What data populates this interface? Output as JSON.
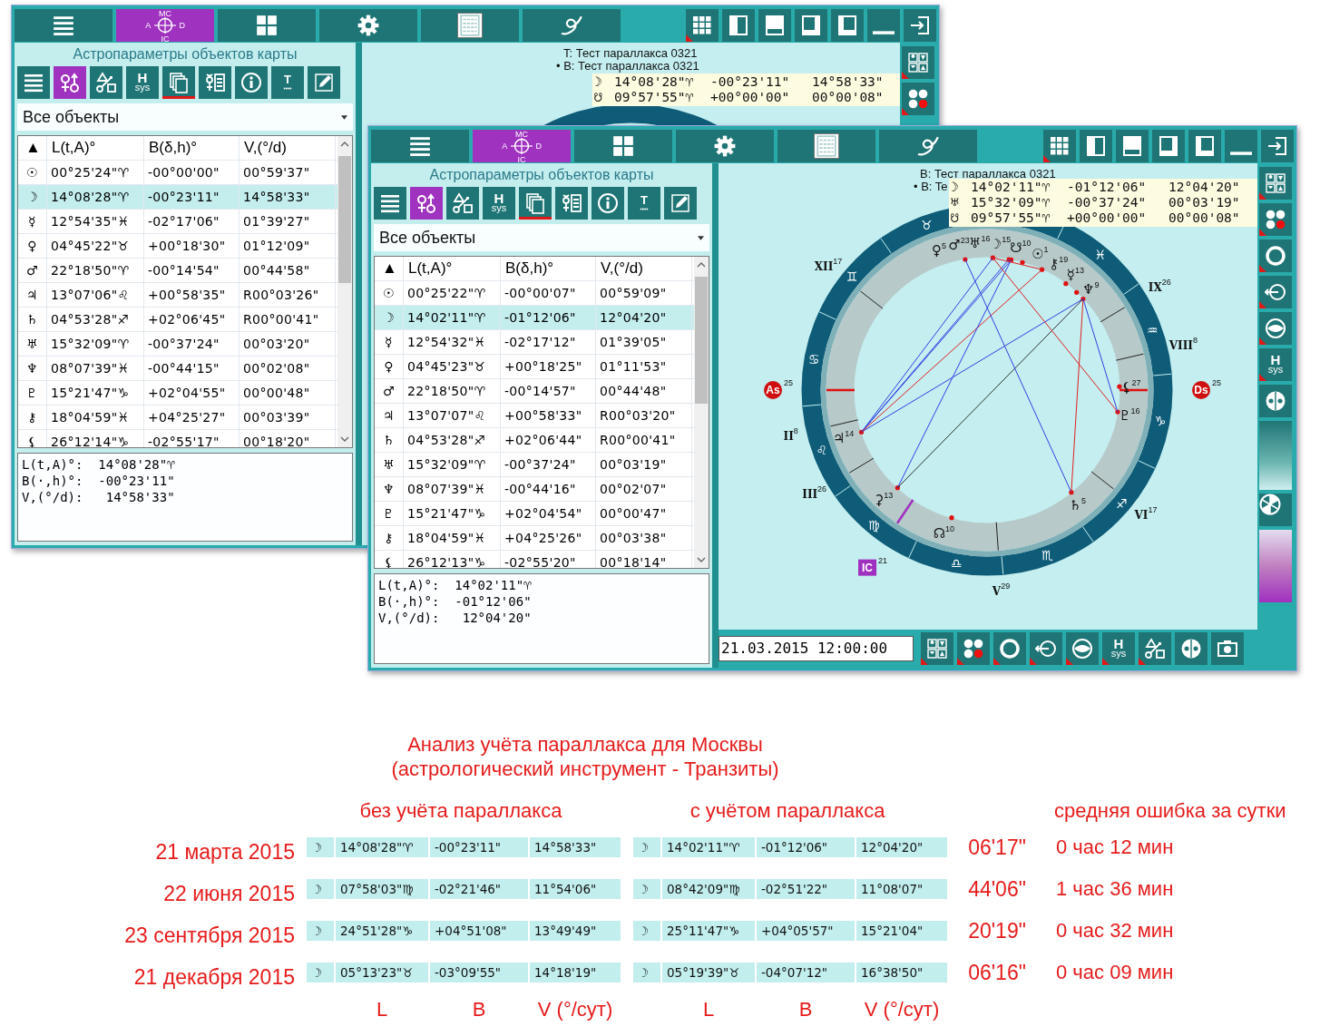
{
  "back_window": {
    "main_tabs": [
      {
        "kind": "list",
        "selected": false
      },
      {
        "kind": "cross",
        "labels": [
          "MC",
          "A",
          "D",
          "IC"
        ],
        "selected": true
      },
      {
        "kind": "grid4",
        "selected": false
      },
      {
        "kind": "gear",
        "selected": false
      },
      {
        "kind": "table",
        "selected": false
      },
      {
        "kind": "swirl",
        "selected": false
      }
    ],
    "layout_buttons": [
      {
        "kind": "grid9",
        "marked": true
      },
      {
        "kind": "split-left",
        "marked": false
      },
      {
        "kind": "pane-top",
        "marked": false
      },
      {
        "kind": "pane-bottom-left",
        "marked": false
      },
      {
        "kind": "pane-top-right",
        "marked": false
      },
      {
        "kind": "minimize",
        "marked": false
      },
      {
        "kind": "exit",
        "marked": false
      }
    ],
    "panel": {
      "title": "Астропараметры объектов карты",
      "tools": [
        {
          "kind": "list",
          "selected": false,
          "active": false
        },
        {
          "kind": "planets",
          "selected": true,
          "active": false
        },
        {
          "kind": "aspects",
          "selected": false,
          "active": false
        },
        {
          "kind": "house-system",
          "label_lines": [
            "H",
            "sys"
          ],
          "selected": false,
          "active": false
        },
        {
          "kind": "copy",
          "selected": false,
          "active": true
        },
        {
          "kind": "glyph-list",
          "selected": false,
          "active": false
        },
        {
          "kind": "info",
          "selected": false,
          "active": false
        },
        {
          "kind": "dots-line",
          "label": "T",
          "selected": false,
          "active": false
        },
        {
          "kind": "edit",
          "selected": false,
          "active": false
        }
      ],
      "filter": "Все объекты",
      "columns": [
        "▲",
        "L(t,A)°",
        "B(δ,h)°",
        "V,(°/d)"
      ],
      "rows": [
        {
          "symbol": "☉",
          "longitude": "00°25'24\"♈",
          "latitude": "-00°00'00\"",
          "speed": "00°59'37\"",
          "selected": false
        },
        {
          "symbol": "☽",
          "longitude": "14°08'28\"♈",
          "latitude": "-00°23'11\"",
          "speed": "14°58'33\"",
          "selected": true
        },
        {
          "symbol": "☿",
          "longitude": "12°54'35\"♓",
          "latitude": "-02°17'06\"",
          "speed": "01°39'27\"",
          "selected": false
        },
        {
          "symbol": "♀",
          "longitude": "04°45'22\"♉",
          "latitude": "+00°18'30\"",
          "speed": "01°12'09\"",
          "selected": false
        },
        {
          "symbol": "♂",
          "longitude": "22°18'50\"♈",
          "latitude": "-00°14'54\"",
          "speed": "00°44'58\"",
          "selected": false
        },
        {
          "symbol": "♃",
          "longitude": "13°07'06\"♌",
          "latitude": "+00°58'35\"",
          "speed": "R00°03'26\"",
          "selected": false
        },
        {
          "symbol": "♄",
          "longitude": "04°53'28\"♐",
          "latitude": "+02°06'45\"",
          "speed": "R00°00'41\"",
          "selected": false
        },
        {
          "symbol": "♅",
          "longitude": "15°32'09\"♈",
          "latitude": "-00°37'24\"",
          "speed": "00°03'20\"",
          "selected": false
        },
        {
          "symbol": "♆",
          "longitude": "08°07'39\"♓",
          "latitude": "-00°44'15\"",
          "speed": "00°02'08\"",
          "selected": false
        },
        {
          "symbol": "♇",
          "longitude": "15°21'47\"♑",
          "latitude": "+02°04'55\"",
          "speed": "00°00'48\"",
          "selected": false
        },
        {
          "symbol": "⚷",
          "longitude": "18°04'59\"♓",
          "latitude": "+04°25'27\"",
          "speed": "00°03'39\"",
          "selected": false
        },
        {
          "symbol": "⚸",
          "longitude": "26°12'14\"♑",
          "latitude": "-02°55'17\"",
          "speed": "00°18'20\"",
          "selected": false
        }
      ],
      "details": [
        "L(t,A)°:  14°08'28\"♈",
        "B(·,h)°:  -00°23'11\"",
        "V,(°/d):   14°58'33\""
      ]
    },
    "chart": {
      "header": [
        "T: Тест параллакса 0321",
        "• B: Тест параллакса 0321"
      ],
      "tooltip": [
        {
          "symbol": "☽",
          "longitude": "14°08'28\"♈",
          "latitude": "-00°23'11\"",
          "speed": "14°58'33\""
        },
        {
          "symbol": "☋",
          "longitude": "09°57'55\"♈",
          "latitude": "+00°00'00\"",
          "speed": "00°00'08\""
        }
      ],
      "side_tools": [
        {
          "kind": "figures",
          "marked": true
        },
        {
          "kind": "dots",
          "marked": true
        }
      ]
    }
  },
  "front_window": {
    "main_tabs": [
      {
        "kind": "list",
        "selected": false
      },
      {
        "kind": "cross",
        "labels": [
          "MC",
          "A",
          "D",
          "IC"
        ],
        "selected": true
      },
      {
        "kind": "grid4",
        "selected": false
      },
      {
        "kind": "gear",
        "selected": false
      },
      {
        "kind": "table",
        "selected": false
      },
      {
        "kind": "swirl",
        "selected": false
      }
    ],
    "layout_buttons": [
      {
        "kind": "grid9",
        "marked": true
      },
      {
        "kind": "split-left",
        "marked": false
      },
      {
        "kind": "pane-top",
        "marked": false
      },
      {
        "kind": "pane-bottom-left",
        "marked": false
      },
      {
        "kind": "pane-top-right",
        "marked": false
      },
      {
        "kind": "minimize",
        "marked": false
      },
      {
        "kind": "exit",
        "marked": false
      }
    ],
    "panel": {
      "title": "Астропараметры объектов карты",
      "tools": [
        {
          "kind": "list",
          "selected": false,
          "active": false
        },
        {
          "kind": "planets",
          "selected": true,
          "active": false
        },
        {
          "kind": "aspects",
          "selected": false,
          "active": false
        },
        {
          "kind": "house-system",
          "label_lines": [
            "H",
            "sys"
          ],
          "selected": false,
          "active": false
        },
        {
          "kind": "copy",
          "selected": false,
          "active": true
        },
        {
          "kind": "glyph-list",
          "selected": false,
          "active": false
        },
        {
          "kind": "info",
          "selected": false,
          "active": false
        },
        {
          "kind": "dots-line",
          "label": "T",
          "selected": false,
          "active": false
        },
        {
          "kind": "edit",
          "selected": false,
          "active": false
        }
      ],
      "filter": "Все объекты",
      "columns": [
        "▲",
        "L(t,A)°",
        "B(δ,h)°",
        "V,(°/d)"
      ],
      "rows": [
        {
          "symbol": "☉",
          "longitude": "00°25'22\"♈",
          "latitude": "-00°00'07\"",
          "speed": "00°59'09\"",
          "selected": false
        },
        {
          "symbol": "☽",
          "longitude": "14°02'11\"♈",
          "latitude": "-01°12'06\"",
          "speed": "12°04'20\"",
          "selected": true
        },
        {
          "symbol": "☿",
          "longitude": "12°54'32\"♓",
          "latitude": "-02°17'12\"",
          "speed": "01°39'05\"",
          "selected": false
        },
        {
          "symbol": "♀",
          "longitude": "04°45'23\"♉",
          "latitude": "+00°18'25\"",
          "speed": "01°11'53\"",
          "selected": false
        },
        {
          "symbol": "♂",
          "longitude": "22°18'50\"♈",
          "latitude": "-00°14'57\"",
          "speed": "00°44'48\"",
          "selected": false
        },
        {
          "symbol": "♃",
          "longitude": "13°07'07\"♌",
          "latitude": "+00°58'33\"",
          "speed": "R00°03'20\"",
          "selected": false
        },
        {
          "symbol": "♄",
          "longitude": "04°53'28\"♐",
          "latitude": "+02°06'44\"",
          "speed": "R00°00'41\"",
          "selected": false
        },
        {
          "symbol": "♅",
          "longitude": "15°32'09\"♈",
          "latitude": "-00°37'24\"",
          "speed": "00°03'19\"",
          "selected": false
        },
        {
          "symbol": "♆",
          "longitude": "08°07'39\"♓",
          "latitude": "-00°44'16\"",
          "speed": "00°02'07\"",
          "selected": false
        },
        {
          "symbol": "♇",
          "longitude": "15°21'47\"♑",
          "latitude": "+02°04'54\"",
          "speed": "00°00'47\"",
          "selected": false
        },
        {
          "symbol": "⚷",
          "longitude": "18°04'59\"♓",
          "latitude": "+04°25'26\"",
          "speed": "00°03'38\"",
          "selected": false
        },
        {
          "symbol": "⚸",
          "longitude": "26°12'13\"♑",
          "latitude": "-02°55'20\"",
          "speed": "00°18'14\"",
          "selected": false
        }
      ],
      "details": [
        "L(t,A)°:  14°02'11\"♈",
        "B(·,h)°:  -01°12'06\"",
        "V,(°/d):   12°04'20\""
      ]
    },
    "chart": {
      "header": [
        "B: Тест параллакса 0321",
        "• B: Te"
      ],
      "tooltip": [
        {
          "symbol": "☽",
          "longitude": "14°02'11\"♈",
          "latitude": "-01°12'06\"",
          "speed": "12°04'20\""
        },
        {
          "symbol": "♅",
          "longitude": "15°32'09\"♈",
          "latitude": "-00°37'24\"",
          "speed": "00°03'19\""
        },
        {
          "symbol": "☋",
          "longitude": "09°57'55\"♈",
          "latitude": "+00°00'00\"",
          "speed": "00°00'08\""
        }
      ],
      "wheel": {
        "signs": [
          {
            "glyph": "♉",
            "kind": "taurus"
          },
          {
            "glyph": "♊",
            "kind": "gemini"
          },
          {
            "glyph": "♋",
            "kind": "cancer"
          },
          {
            "glyph": "♌",
            "kind": "leo"
          },
          {
            "glyph": "♍",
            "kind": "virgo"
          },
          {
            "glyph": "♎",
            "kind": "libra"
          },
          {
            "glyph": "♏",
            "kind": "scorpio"
          },
          {
            "glyph": "♐",
            "kind": "sagittarius"
          },
          {
            "glyph": "♑",
            "kind": "capricorn"
          },
          {
            "glyph": "♒",
            "kind": "aquarius"
          },
          {
            "glyph": "♓",
            "kind": "pisces"
          }
        ],
        "ascendant": {
          "numeral": "As",
          "degree": "25",
          "kind": "cancer"
        },
        "descendant": {
          "numeral": "Ds",
          "degree": "25",
          "kind": "capricorn"
        },
        "ic": {
          "numeral": "IC",
          "degree": "21",
          "kind": "virgo"
        },
        "cusps": [
          {
            "numeral": "II",
            "degree": "8",
            "kind": "leo"
          },
          {
            "numeral": "III",
            "degree": "26",
            "kind": "leo"
          },
          {
            "numeral": "V",
            "degree": "29",
            "kind": "libra"
          },
          {
            "numeral": "VI",
            "degree": "17",
            "kind": "sagittarius"
          },
          {
            "numeral": "VIII",
            "degree": "8",
            "kind": "aquarius"
          },
          {
            "numeral": "IX",
            "degree": "26",
            "kind": "aquarius"
          },
          {
            "numeral": "XII",
            "degree": "17",
            "kind": "gemini"
          }
        ],
        "planets": [
          {
            "glyph": "♀",
            "degree": "5",
            "kind": "taurus"
          },
          {
            "glyph": "♂",
            "degree": "23",
            "kind": "aries"
          },
          {
            "glyph": "♅",
            "degree": "16",
            "kind": "aries"
          },
          {
            "glyph": "☽",
            "degree": "15",
            "kind": "aries"
          },
          {
            "glyph": "☋",
            "degree": "10",
            "kind": "aries"
          },
          {
            "glyph": "☉",
            "degree": "1",
            "kind": "aries"
          },
          {
            "glyph": "⚷",
            "degree": "19",
            "kind": "pisces"
          },
          {
            "glyph": "☿",
            "degree": "13",
            "kind": "pisces"
          },
          {
            "glyph": "♆",
            "degree": "9",
            "kind": "pisces"
          },
          {
            "glyph": "⚸",
            "degree": "27",
            "kind": "capricorn"
          },
          {
            "glyph": "♇",
            "degree": "16",
            "kind": "capricorn"
          },
          {
            "glyph": "♄",
            "degree": "5",
            "kind": "sagittarius"
          },
          {
            "glyph": "☊",
            "degree": "10",
            "kind": "libra"
          },
          {
            "glyph": "⚳",
            "degree": "13",
            "kind": "virgo"
          },
          {
            "glyph": "♃",
            "degree": "14",
            "kind": "leo"
          }
        ]
      },
      "side_tools": [
        {
          "kind": "figures",
          "marked": true
        },
        {
          "kind": "dots",
          "marked": true
        },
        {
          "kind": "ring",
          "marked": true
        },
        {
          "kind": "arrow-circle",
          "marked": true
        },
        {
          "kind": "eye",
          "marked": true
        },
        {
          "kind": "house-system",
          "label_lines": [
            "H",
            "sys"
          ],
          "marked": true
        },
        {
          "kind": "halves",
          "marked": false
        },
        {
          "kind": "gradient-teal",
          "marked": false
        },
        {
          "kind": "wheel",
          "marked": false
        },
        {
          "kind": "gradient-purple",
          "marked": false
        }
      ],
      "date": "21.03.2015 12:00:00",
      "bottom_tools": [
        {
          "kind": "figures",
          "marked": true
        },
        {
          "kind": "dots",
          "marked": true
        },
        {
          "kind": "ring",
          "marked": true
        },
        {
          "kind": "arrow-circle",
          "marked": true
        },
        {
          "kind": "eye",
          "marked": true
        },
        {
          "kind": "house-system",
          "label_lines": [
            "H",
            "sys"
          ],
          "marked": true
        },
        {
          "kind": "aspects",
          "marked": true
        },
        {
          "kind": "halves",
          "marked": false
        },
        {
          "kind": "camera",
          "marked": false
        }
      ]
    }
  },
  "analysis": {
    "title": [
      "Анализ учёта параллакса для Москвы",
      "(астрологический инструмент - Транзиты)"
    ],
    "headers": [
      "без учёта параллакса",
      "с учётом параллакса",
      "средняя ошибка за сутки"
    ],
    "rows": [
      {
        "date": "21 марта 2015",
        "without": [
          "☽",
          "14°08'28\"♈",
          "-00°23'11\"",
          "14°58'33\""
        ],
        "with": [
          "☽",
          "14°02'11\"♈",
          "-01°12'06\"",
          "12°04'20\""
        ],
        "error": "06'17\"",
        "daily_error": "0 час 12 мин"
      },
      {
        "date": "22 июня 2015",
        "without": [
          "☽",
          "07°58'03\"♍",
          "-02°21'46\"",
          "11°54'06\""
        ],
        "with": [
          "☽",
          "08°42'09\"♍",
          "-02°51'22\"",
          "11°08'07\""
        ],
        "error": "44'06\"",
        "daily_error": "1 час 36 мин"
      },
      {
        "date": "23 сентября 2015",
        "without": [
          "☽",
          "24°51'28\"♑",
          "+04°51'08\"",
          "13°49'49\""
        ],
        "with": [
          "☽",
          "25°11'47\"♑",
          "+04°05'57\"",
          "15°21'04\""
        ],
        "error": "20'19\"",
        "daily_error": "0 час 32 мин"
      },
      {
        "date": "21 декабря 2015",
        "without": [
          "☽",
          "05°13'23\"♉",
          "-03°09'55\"",
          "14°18'19\""
        ],
        "with": [
          "☽",
          "05°19'39\"♉",
          "-04°07'12\"",
          "16°38'50\""
        ],
        "error": "06'16\"",
        "daily_error": "0 час 09 мин"
      }
    ],
    "labels_without": [
      "L",
      "B",
      "V (°/сут)"
    ],
    "labels_with": [
      "L",
      "B",
      "V (°/сут)"
    ]
  }
}
